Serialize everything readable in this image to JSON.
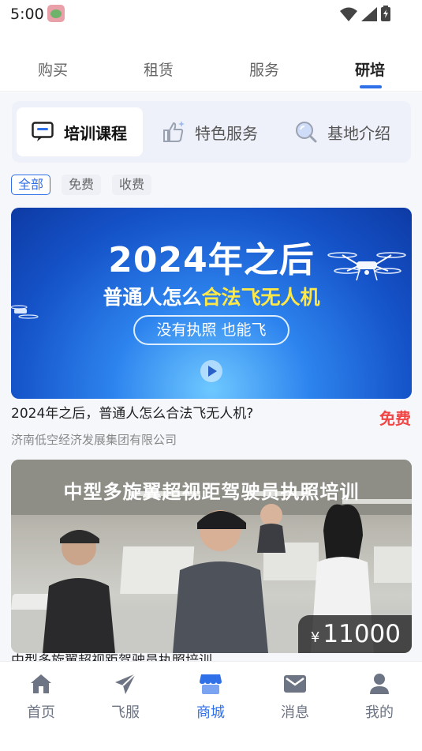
{
  "status_bar": {
    "time": "5:00"
  },
  "top_tabs": [
    {
      "label": "购买"
    },
    {
      "label": "租赁"
    },
    {
      "label": "服务"
    },
    {
      "label": "研培"
    }
  ],
  "active_top_tab": "研培",
  "categories": [
    {
      "label": "培训课程",
      "icon": "chat-icon",
      "active": true
    },
    {
      "label": "特色服务",
      "icon": "thumbs-up-icon",
      "active": false
    },
    {
      "label": "基地介绍",
      "icon": "magnifier-icon",
      "active": false
    }
  ],
  "filters": [
    {
      "label": "全部",
      "active": true
    },
    {
      "label": "免费",
      "active": false
    },
    {
      "label": "收费",
      "active": false
    }
  ],
  "courses": [
    {
      "banner_title": "2024年之后",
      "banner_sub_before": "普通人怎么",
      "banner_sub_highlight": "合法飞无人机",
      "banner_pill": "没有执照 也能飞",
      "title": "2024年之后，普通人怎么合法飞无人机?",
      "price": "免费",
      "org": "济南低空经济发展集团有限公司"
    },
    {
      "banner_title": "中型多旋翼超视距驾驶员执照培训",
      "price_currency": "¥",
      "price_amount": "11000",
      "title": "中型多旋翼超视距驾驶员执照培训"
    }
  ],
  "bottom_nav": [
    {
      "label": "首页",
      "icon": "home-icon"
    },
    {
      "label": "飞服",
      "icon": "paper-plane-icon"
    },
    {
      "label": "商城",
      "icon": "store-icon"
    },
    {
      "label": "消息",
      "icon": "envelope-icon"
    },
    {
      "label": "我的",
      "icon": "user-icon"
    }
  ],
  "active_bottom_nav": "商城",
  "colors": {
    "accent": "#2f6fe8",
    "price_free": "#f04646",
    "nav_inactive": "#6d7484"
  }
}
